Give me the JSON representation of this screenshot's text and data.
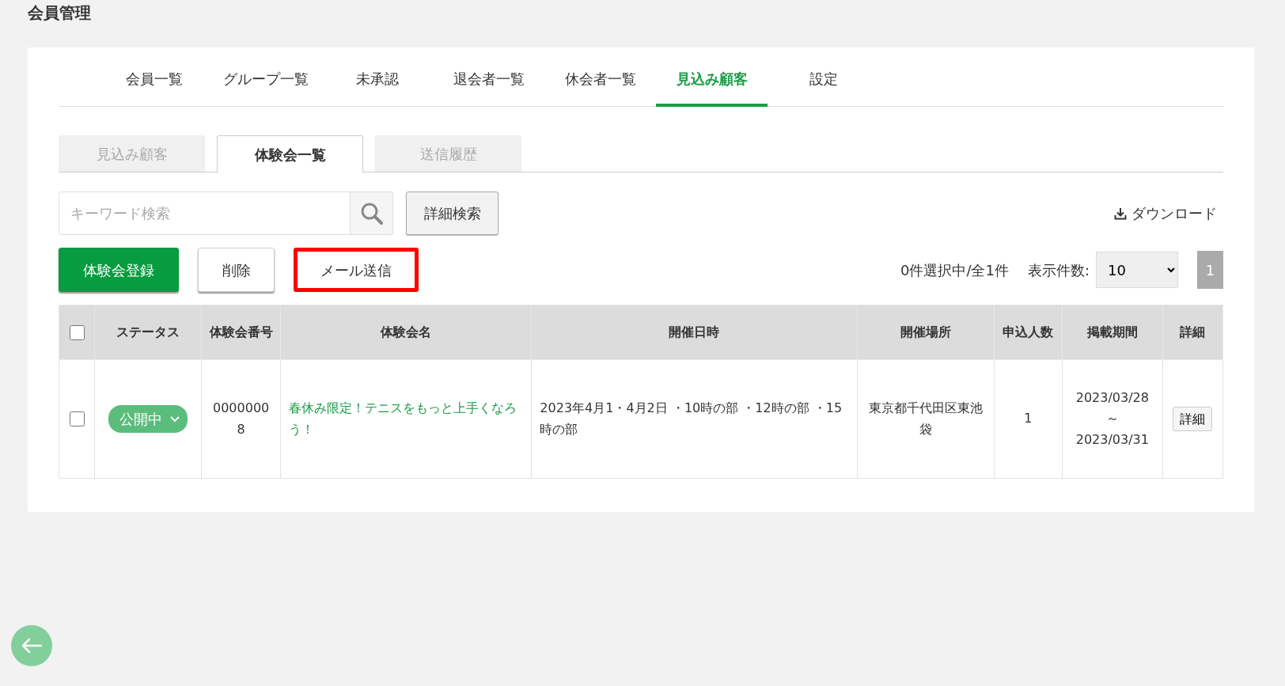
{
  "page_title": "会員管理",
  "main_tabs": [
    {
      "label": "会員一覧",
      "selected": false
    },
    {
      "label": "グループ一覧",
      "selected": false
    },
    {
      "label": "未承認",
      "selected": false
    },
    {
      "label": "退会者一覧",
      "selected": false
    },
    {
      "label": "休会者一覧",
      "selected": false
    },
    {
      "label": "見込み顧客",
      "selected": true
    },
    {
      "label": "設定",
      "selected": false
    }
  ],
  "sub_tabs": [
    {
      "label": "見込み顧客",
      "selected": false
    },
    {
      "label": "体験会一覧",
      "selected": true
    },
    {
      "label": "送信履歴",
      "selected": false
    }
  ],
  "search": {
    "placeholder": "キーワード検索"
  },
  "advanced_search_button": "詳細検索",
  "download_link": "ダウンロード",
  "action_buttons": [
    {
      "label": "体験会登録",
      "kind": "primary",
      "highlighted": false
    },
    {
      "label": "削除",
      "kind": "default",
      "highlighted": false
    },
    {
      "label": "メール送信",
      "kind": "plain",
      "highlighted": true
    }
  ],
  "selection_count": "0件選択中/全1件",
  "page_size": {
    "label": "表示件数:",
    "value": "10"
  },
  "pagination": [
    {
      "label": "1",
      "selected": true
    }
  ],
  "table": {
    "select_all_checked": false,
    "columns": [
      "ステータス",
      "体験会番号",
      "体験会名",
      "開催日時",
      "開催場所",
      "申込人数",
      "掲載期間",
      "詳細"
    ],
    "rows": [
      {
        "checked": false,
        "status": "公開中",
        "number": "00000008",
        "name": "春休み限定！テニスをもっと上手くなろう！",
        "datetime": "2023年4月1・4月2日 ・10時の部 ・12時の部 ・15時の部",
        "place": "東京都千代田区東池袋",
        "applicants": "1",
        "period_start": "2023/03/28",
        "period_separator": "～",
        "period_end": "2023/03/31",
        "detail_button": "詳細"
      }
    ]
  }
}
